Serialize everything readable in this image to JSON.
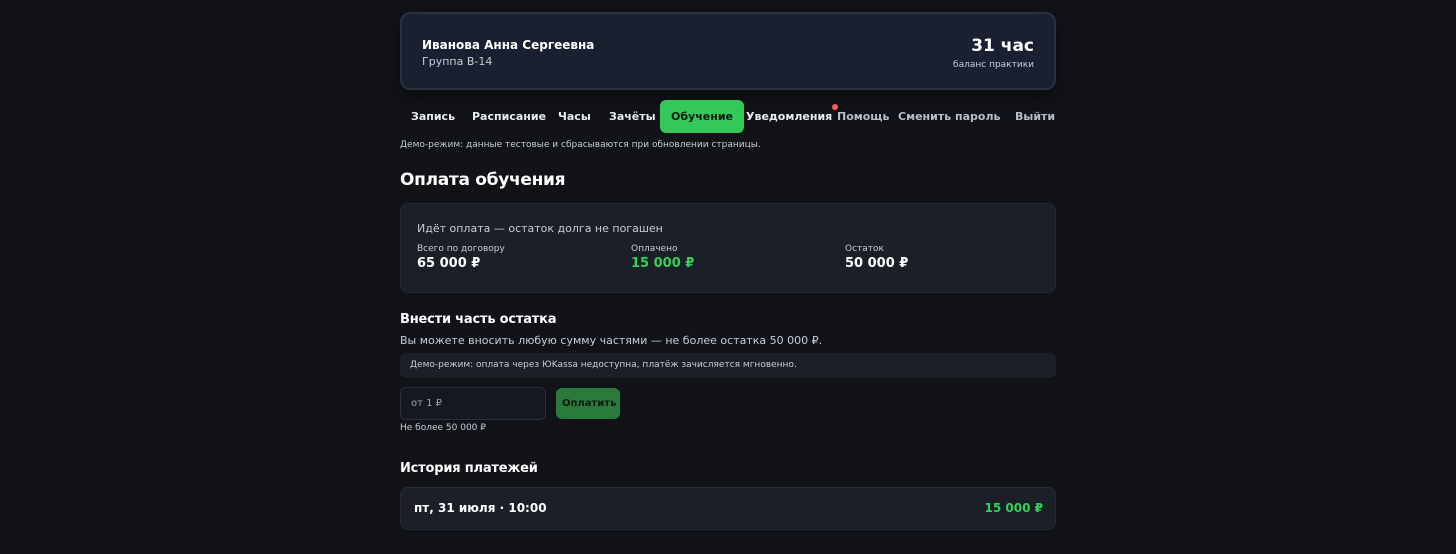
{
  "student": {
    "name": "Иванова Анна Сергеевна",
    "group": "Группа В-14",
    "hours": "31 час",
    "hours_caption": "баланс практики"
  },
  "nav": {
    "items": [
      {
        "label": "Запись"
      },
      {
        "label": "Расписание"
      },
      {
        "label": "Часы"
      },
      {
        "label": "Зачёты"
      },
      {
        "label": "Обучение",
        "active": true
      },
      {
        "label": "Уведомления",
        "badge": true
      },
      {
        "label": "Помощь"
      },
      {
        "label": "Сменить пароль"
      },
      {
        "label": "Выйти"
      }
    ]
  },
  "demo_note": "Демо-режим: данные тестовые и сбрасываются при обновлении страницы.",
  "page_title": "Оплата обучения",
  "summary": {
    "status": "Идёт оплата — остаток долга не погашен",
    "total_label": "Всего по договору",
    "total_value": "65 000 ₽",
    "paid_label": "Оплачено",
    "paid_value": "15 000 ₽",
    "rest_label": "Остаток",
    "rest_value": "50 000 ₽"
  },
  "partial": {
    "title": "Внести часть остатка",
    "hint": "Вы можете вносить любую сумму частями — не более остатка 50 000 ₽.",
    "demo_box": "Демо-режим: оплата через ЮKassa недоступна, платёж зачисляется мгновенно.",
    "input_placeholder": "от 1 ₽",
    "pay_button": "Оплатить",
    "limit": "Не более 50 000 ₽"
  },
  "history": {
    "title": "История платежей",
    "rows": [
      {
        "date": "пт, 31 июля · 10:00",
        "amount": "15 000 ₽"
      }
    ]
  },
  "colors": {
    "accent": "#34c759",
    "background": "#111318",
    "badge": "#ff5a5a"
  }
}
